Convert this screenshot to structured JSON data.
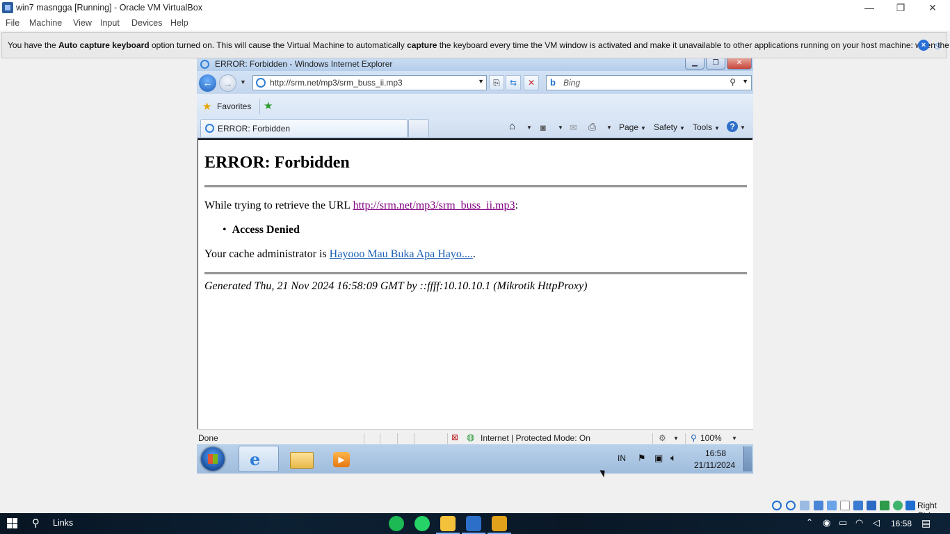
{
  "host": {
    "title": "win7 masngga [Running] - Oracle VM VirtualBox",
    "window_controls": {
      "minimize": "—",
      "restore": "❐",
      "close": "✕"
    },
    "menu": [
      "File",
      "Machine",
      "View",
      "Input",
      "Devices",
      "Help"
    ],
    "notice": {
      "part1": "You have the ",
      "bold1": "Auto capture keyboard",
      "part2": " option turned on. This will cause the Virtual Machine to automatically ",
      "bold2": "capture",
      "part3": " the keyboard every time the VM window is activated and make it unavailable to other applications running on your host machine: when the keyboard is"
    },
    "status_right": "Right Ctrl"
  },
  "ie": {
    "window_title": "ERROR: Forbidden - Windows Internet Explorer",
    "url": "http://srm.net/mp3/srm_buss_ii.mp3",
    "search_placeholder": "Bing",
    "favorites_label": "Favorites",
    "tab_label": "ERROR: Forbidden",
    "commands": {
      "page": "Page",
      "safety": "Safety",
      "tools": "Tools"
    },
    "status": {
      "done": "Done",
      "zone": "Internet | Protected Mode: On",
      "zoom": "100%"
    }
  },
  "page": {
    "heading": "ERROR: Forbidden",
    "retrieve_prefix": "While trying to retrieve the URL ",
    "retrieve_link": "http://srm.net/mp3/srm_buss_ii.mp3",
    "retrieve_suffix": ":",
    "bullet": "Access Denied",
    "admin_prefix": "Your cache administrator is ",
    "admin_link": "Hayooo Mau Buka Apa Hayo....",
    "admin_suffix": ".",
    "generated": "Generated Thu, 21 Nov 2024 16:58:09 GMT by ::ffff:10.10.10.1 (Mikrotik HttpProxy)"
  },
  "guest_tray": {
    "lang": "IN",
    "time": "16:58",
    "date": "21/11/2024"
  },
  "win10": {
    "search_label": "Links",
    "clock": "16:58"
  }
}
